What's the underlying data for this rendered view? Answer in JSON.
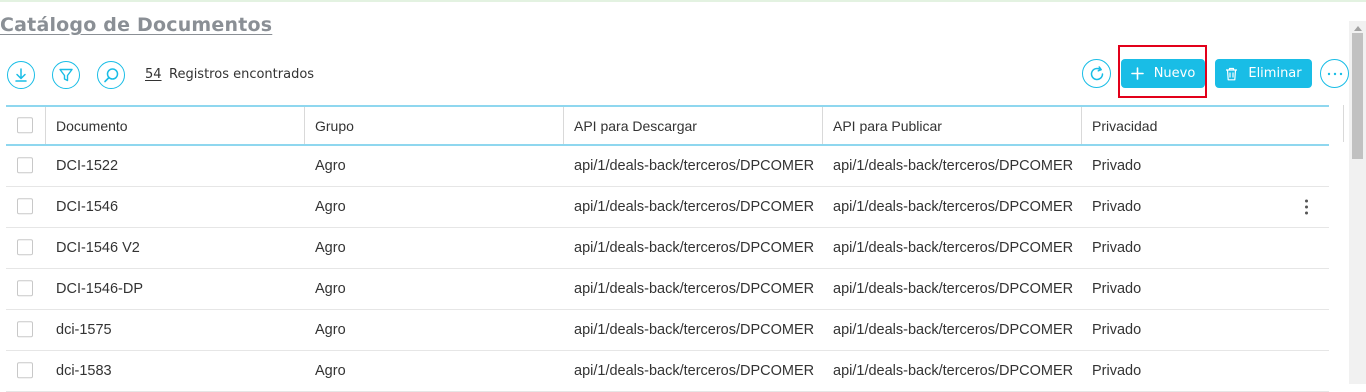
{
  "page": {
    "title": "Catálogo de Documentos"
  },
  "toolbar": {
    "record_count": "54",
    "record_label": "Registros encontrados",
    "new_label": "Nuevo",
    "delete_label": "Eliminar",
    "icons": {
      "download": "download-icon",
      "filter": "filter-icon",
      "search": "search-icon",
      "refresh": "refresh-icon",
      "more": "more-options-icon"
    }
  },
  "colors": {
    "accent": "#19bde6",
    "highlight": "#e2001a",
    "title": "#8a8f95"
  },
  "table": {
    "headers": [
      "Documento",
      "Grupo",
      "API para Descargar",
      "API para Publicar",
      "Privacidad"
    ],
    "rows": [
      {
        "documento": "DCI-1522",
        "grupo": "Agro",
        "api_descargar": "api/1/deals-back/terceros/DPCOMER",
        "api_publicar": "api/1/deals-back/terceros/DPCOMER",
        "privacidad": "Privado"
      },
      {
        "documento": "DCI-1546",
        "grupo": "Agro",
        "api_descargar": "api/1/deals-back/terceros/DPCOMER",
        "api_publicar": "api/1/deals-back/terceros/DPCOMER",
        "privacidad": "Privado"
      },
      {
        "documento": "DCI-1546 V2",
        "grupo": "Agro",
        "api_descargar": "api/1/deals-back/terceros/DPCOMER",
        "api_publicar": "api/1/deals-back/terceros/DPCOMER",
        "privacidad": "Privado"
      },
      {
        "documento": "DCI-1546-DP",
        "grupo": "Agro",
        "api_descargar": "api/1/deals-back/terceros/DPCOMER",
        "api_publicar": "api/1/deals-back/terceros/DPCOMER",
        "privacidad": "Privado"
      },
      {
        "documento": "dci-1575",
        "grupo": "Agro",
        "api_descargar": "api/1/deals-back/terceros/DPCOMER",
        "api_publicar": "api/1/deals-back/terceros/DPCOMER",
        "privacidad": "Privado"
      },
      {
        "documento": "dci-1583",
        "grupo": "Agro",
        "api_descargar": "api/1/deals-back/terceros/DPCOMER",
        "api_publicar": "api/1/deals-back/terceros/DPCOMER",
        "privacidad": "Privado"
      }
    ]
  }
}
